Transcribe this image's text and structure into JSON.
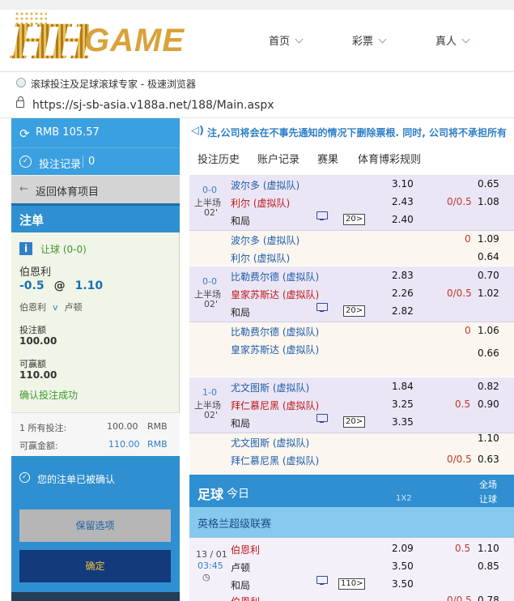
{
  "site": {
    "logo_hh": "HH",
    "logo_game": "GAME",
    "nav": [
      {
        "label": "首页"
      },
      {
        "label": "彩票"
      },
      {
        "label": "真人"
      }
    ]
  },
  "browser": {
    "title": "滚球投注及足球滚球专家 - 极速浏览器",
    "url": "https://sj-sb-asia.v188a.net/188/Main.aspx"
  },
  "left": {
    "balance": "RMB 105.57",
    "bet_record_label": "投注记录",
    "bet_record_count": "0",
    "back_label": "返回体育项目",
    "slip_title": "注单",
    "bet_type": "让球 (0-0)",
    "bet_team": "伯恩利",
    "handicap": "-0.5",
    "at": "@",
    "price": "1.10",
    "home": "伯恩利",
    "vs": "v",
    "away": "卢顿",
    "stake_label": "投注额",
    "stake_value": "100.00",
    "win_label": "可赢额",
    "win_value": "110.00",
    "success": "确认投注成功",
    "total_count_label": "1  所有投注:",
    "total_stake": "100.00",
    "currency": "RMB",
    "total_win_label": "可赢金额:",
    "total_win": "110.00",
    "confirmed_msg": "您的注单已被确认",
    "keep_button": "保留选项",
    "confirm_button": "确定"
  },
  "right": {
    "marquee": "注,公司将会在不事先通知的情况下删除票根. 同时, 公司将不承担所有",
    "tabs": [
      "投注历史",
      "账户记录",
      "赛果",
      "体育博彩规则"
    ],
    "matches": [
      {
        "score": "0-0",
        "period": "上半场",
        "minute": "02'",
        "home": "波尔多 (虚拟队)",
        "away": "利尔 (虚拟队)",
        "draw": "和局",
        "x12": [
          "3.10",
          "2.43",
          "2.40"
        ],
        "hdp": "0/0.5",
        "hdp_odds": [
          "0.65",
          "1.08"
        ],
        "more": "20",
        "alt_home": "波尔多 (虚拟队)",
        "alt_away": "利尔 (虚拟队)",
        "alt_hdp": "0",
        "alt_odds": [
          "1.09",
          "0.64"
        ]
      },
      {
        "score": "0-0",
        "period": "上半场",
        "minute": "02'",
        "home": "比勒费尔德 (虚拟队)",
        "away": "皇家苏斯达 (虚拟队)",
        "draw": "和局",
        "x12": [
          "2.83",
          "2.26",
          "2.82"
        ],
        "hdp": "0/0.5",
        "hdp_odds": [
          "0.70",
          "1.02"
        ],
        "more": "20",
        "alt_home": "比勒费尔德 (虚拟队)",
        "alt_away": "皇家苏斯达 (虚拟队)",
        "alt_hdp": "0",
        "alt_odds": [
          "1.06",
          "0.66"
        ]
      },
      {
        "score": "1-0",
        "period": "上半场",
        "minute": "02'",
        "home": "尤文图斯 (虚拟队)",
        "away": "拜仁慕尼黑 (虚拟队)",
        "draw": "和局",
        "x12": [
          "1.84",
          "3.25",
          "3.35"
        ],
        "hdp": "0.5",
        "hdp_odds": [
          "0.82",
          "0.90"
        ],
        "more": "20",
        "alt_home": "尤文图斯 (虚拟队)",
        "alt_away": "拜仁慕尼黑 (虚拟队)",
        "alt_hdp": "0/0.5",
        "alt_odds": [
          "1.10",
          "0.63"
        ]
      }
    ],
    "today_title": "足球",
    "today_sub": "今日",
    "col_1x2": "1X2",
    "col_full": "全场",
    "col_hdp": "让球",
    "league": "英格兰超级联赛",
    "fixture": {
      "date": "13 / 01",
      "time": "03:45",
      "home": "伯恩利",
      "away": "卢顿",
      "draw": "和局",
      "x12": [
        "2.09",
        "3.50",
        "3.50"
      ],
      "hdp": "0.5",
      "hdp_odds": [
        "1.10",
        "0.85"
      ],
      "more": "110"
    },
    "next_home": "伯恩利",
    "next_hdp": "0/0.5",
    "next_odds": "0.78"
  }
}
